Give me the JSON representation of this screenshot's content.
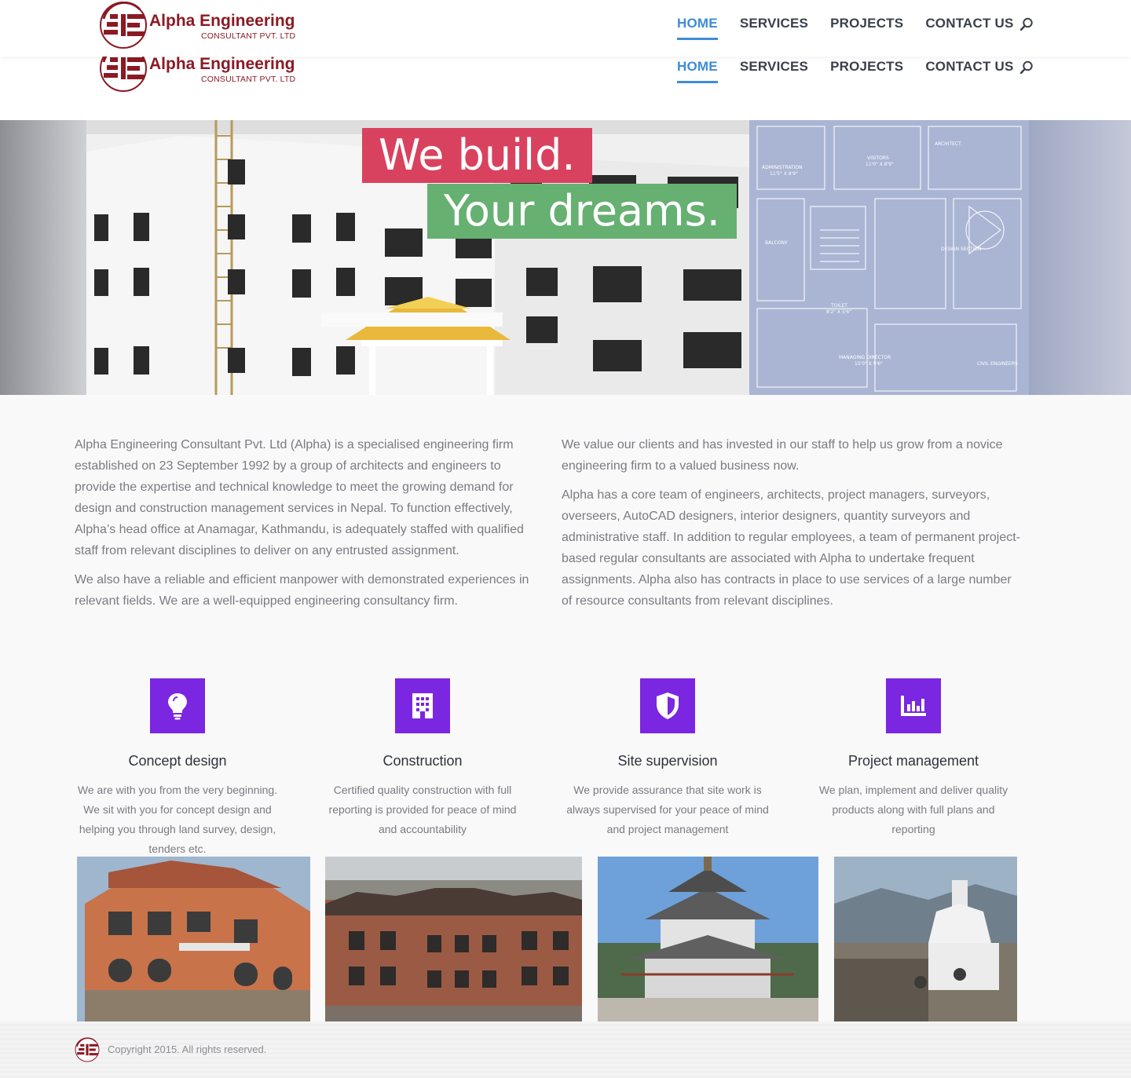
{
  "brand": {
    "name": "Alpha Engineering",
    "subtitle": "CONSULTANT PVT. LTD",
    "accent": "#8b1a24"
  },
  "nav": {
    "items": [
      {
        "label": "HOME",
        "active": true
      },
      {
        "label": "SERVICES",
        "active": false
      },
      {
        "label": "PROJECTS",
        "active": false
      },
      {
        "label": "CONTACT US",
        "active": false
      }
    ],
    "active_color": "#3e8cd8",
    "search_icon": "search-icon"
  },
  "hero": {
    "line1": "We build.",
    "line2": "Your dreams.",
    "line1_color": "#d9425e",
    "line2_color": "#66b072",
    "blueprint_labels": {
      "architect": "ARCHITECT",
      "visitors": "VISITORS",
      "visitors_size": "11'0\" X 8'9\"",
      "administration": "ADMINISTRATION",
      "administration_size": "11'5\" X 8'9\"",
      "balcony": "BALCONY",
      "design_section": "DESIGN SECTION",
      "toilet": "TOILET",
      "toilet_size": "8'2\" X 5'6\"",
      "managing_director": "MANAGING DIRECTOR",
      "managing_director_size": "15'0\" X 9'6\"",
      "civil_engineers": "CIVIL ENGINEERS"
    }
  },
  "about": {
    "left": [
      "Alpha Engineering Consultant Pvt. Ltd (Alpha) is a specialised engineering firm established on 23 September 1992 by a group of architects and engineers to provide the expertise and technical knowledge to meet the growing demand for design and construction management services in Nepal. To function effectively, Alpha’s head office at Anamagar, Kathmandu, is adequately staffed with qualified staff from relevant disciplines to deliver on any entrusted assignment.",
      "We also have a reliable and efficient manpower with demonstrated experiences in relevant fields. We are a well-equipped engineering consultancy firm."
    ],
    "right": [
      "We value our clients and has invested in our staff to help us grow from a novice engineering firm to a valued business now.",
      "Alpha has a core team of engineers, architects, project managers, surveyors, overseers, AutoCAD designers, interior designers, quantity surveyors and administrative staff. In addition to regular employees, a team of permanent project-based regular consultants are associated with Alpha to undertake frequent assignments. Alpha also has contracts in place to use services of a large number of resource consultants from relevant disciplines."
    ]
  },
  "features": {
    "icon_color": "#7b26e0",
    "items": [
      {
        "icon": "lightbulb-icon",
        "title": "Concept design",
        "desc": "We are with you from the very beginning. We sit with you for concept design and helping you through land survey, design, tenders etc."
      },
      {
        "icon": "building-icon",
        "title": "Construction",
        "desc": "Certified quality construction with full reporting is provided for peace of mind and accountability"
      },
      {
        "icon": "shield-icon",
        "title": "Site supervision",
        "desc": "We provide assurance that site work is always supervised for your peace of mind and project management"
      },
      {
        "icon": "bar-chart-icon",
        "title": "Project management",
        "desc": "We plan, implement and deliver quality products along with full plans and reporting"
      }
    ]
  },
  "gallery": {
    "photos": [
      "brick-house-photo",
      "brick-building-photo",
      "pagoda-temple-photo",
      "stupa-photo"
    ]
  },
  "footer": {
    "copyright": "Copyright 2015. All rights reserved."
  }
}
